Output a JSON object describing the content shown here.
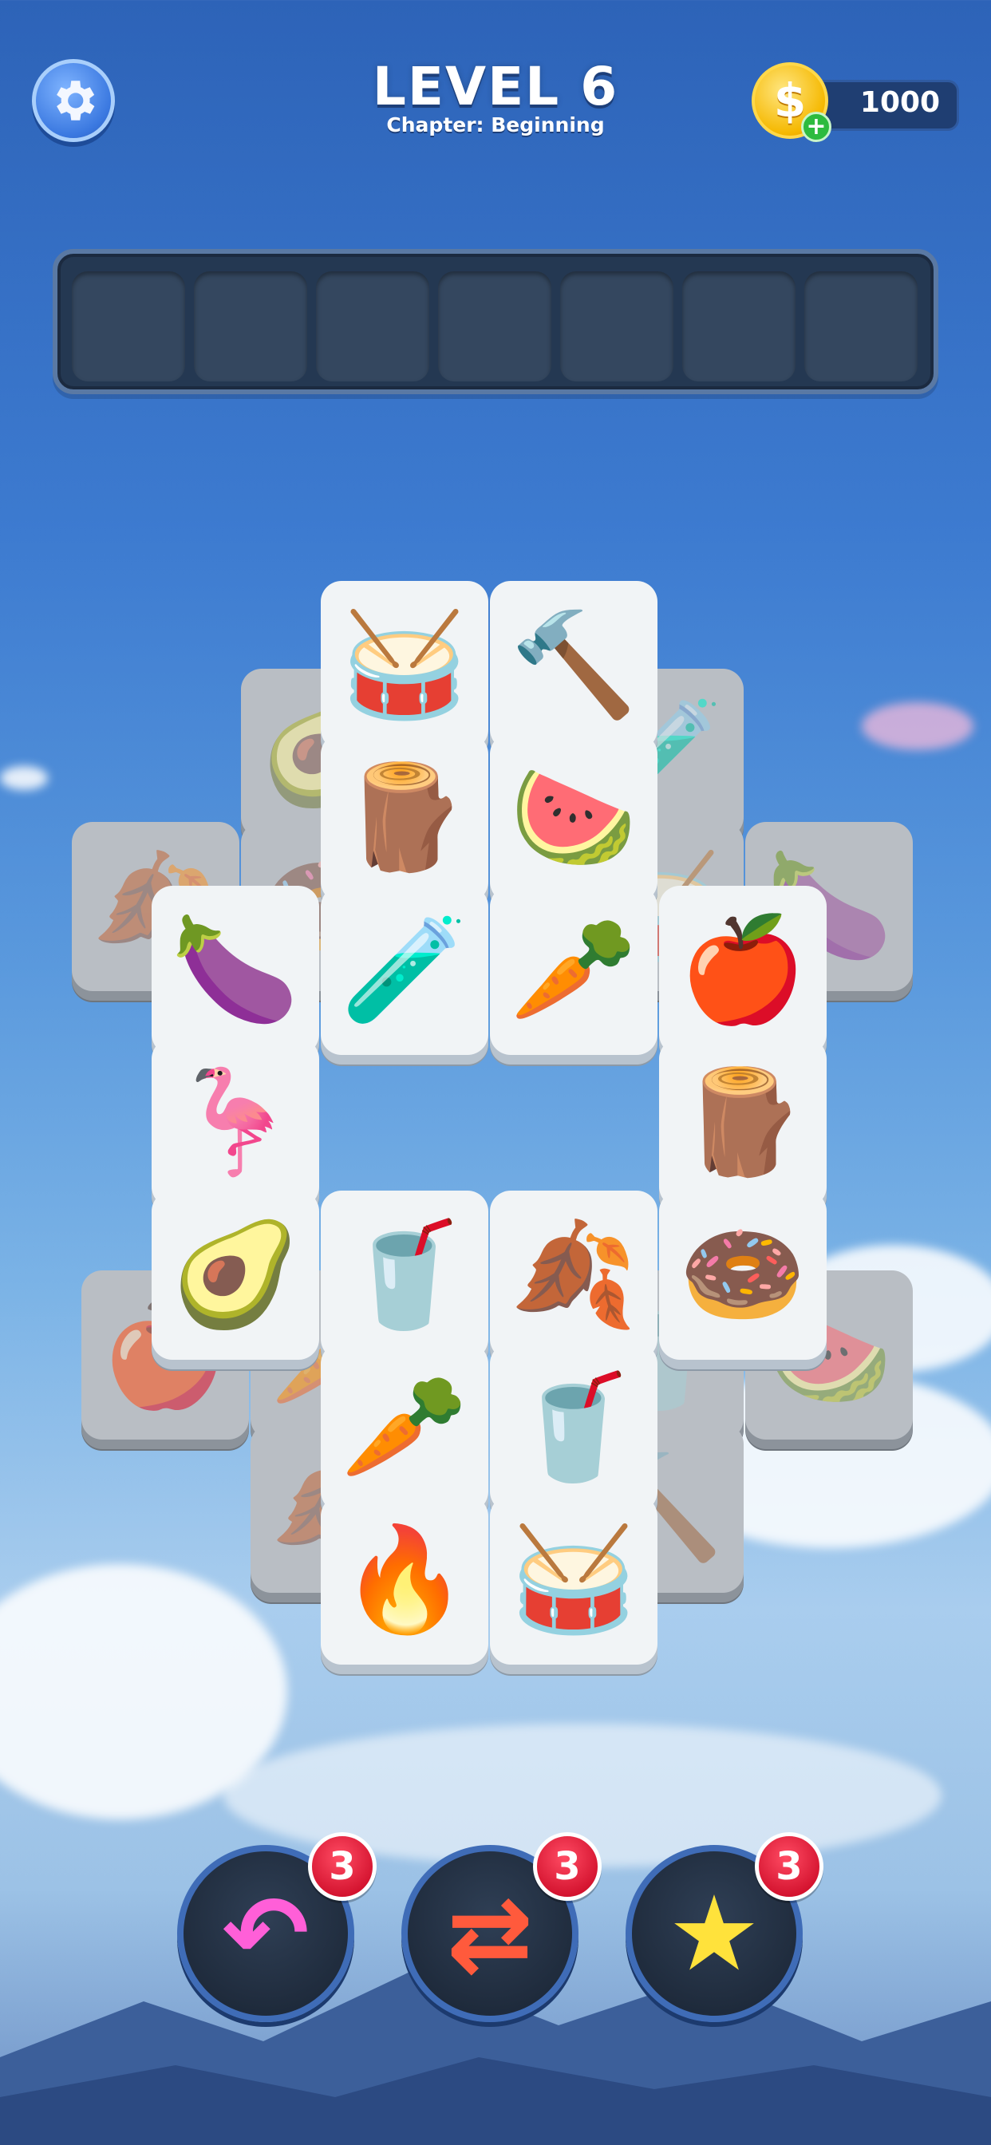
{
  "header": {
    "level_title": "LEVEL 6",
    "chapter": "Chapter: Beginning",
    "coins": "1000",
    "coin_symbol": "$",
    "coin_plus": "+"
  },
  "tray": {
    "slot_count": 7
  },
  "board": {
    "under_tiles": [
      {
        "name": "avocado",
        "glyph": "🥑"
      },
      {
        "name": "potion",
        "glyph": "🧪"
      },
      {
        "name": "leaf",
        "glyph": "🍂"
      },
      {
        "name": "donut",
        "glyph": "🍩"
      },
      {
        "name": "drum",
        "glyph": "🥁"
      },
      {
        "name": "eggplant",
        "glyph": "🍆"
      },
      {
        "name": "apple",
        "glyph": "🍎"
      },
      {
        "name": "carrot",
        "glyph": "🥕"
      },
      {
        "name": "cup",
        "glyph": "🥤"
      },
      {
        "name": "watermelon",
        "glyph": "🍉"
      },
      {
        "name": "leaf",
        "glyph": "🍂"
      },
      {
        "name": "hammer",
        "glyph": "🔨"
      }
    ],
    "top_tiles": [
      {
        "name": "drum",
        "glyph": "🥁"
      },
      {
        "name": "hammer",
        "glyph": "🔨"
      },
      {
        "name": "logs",
        "glyph": "🪵"
      },
      {
        "name": "watermelon",
        "glyph": "🍉"
      },
      {
        "name": "eggplant",
        "glyph": "🍆"
      },
      {
        "name": "potion",
        "glyph": "🧪"
      },
      {
        "name": "carrot",
        "glyph": "🥕"
      },
      {
        "name": "apple",
        "glyph": "🍎"
      },
      {
        "name": "flamingo",
        "glyph": "🦩"
      },
      {
        "name": "logs",
        "glyph": "🪵"
      },
      {
        "name": "avocado",
        "glyph": "🥑"
      },
      {
        "name": "cup",
        "glyph": "🥤"
      },
      {
        "name": "leaf",
        "glyph": "🍂"
      },
      {
        "name": "donut",
        "glyph": "🍩"
      },
      {
        "name": "carrot",
        "glyph": "🥕"
      },
      {
        "name": "cup",
        "glyph": "🥤"
      },
      {
        "name": "campfire",
        "glyph": "🔥"
      },
      {
        "name": "drum",
        "glyph": "🥁"
      }
    ]
  },
  "boosters": [
    {
      "name": "undo",
      "icon": "↶",
      "count": "3",
      "color": "#ff5fd8"
    },
    {
      "name": "shuffle",
      "icon": "⇄",
      "count": "3",
      "color": "#ff5a3c"
    },
    {
      "name": "magic-wand",
      "icon": "★",
      "count": "3",
      "color": "#ffe23b"
    }
  ],
  "colors": {
    "sky_top": "#2d63b8",
    "tray_bg": "#243852",
    "tile_face": "#f1f4f6",
    "badge_red": "#d3122e"
  }
}
